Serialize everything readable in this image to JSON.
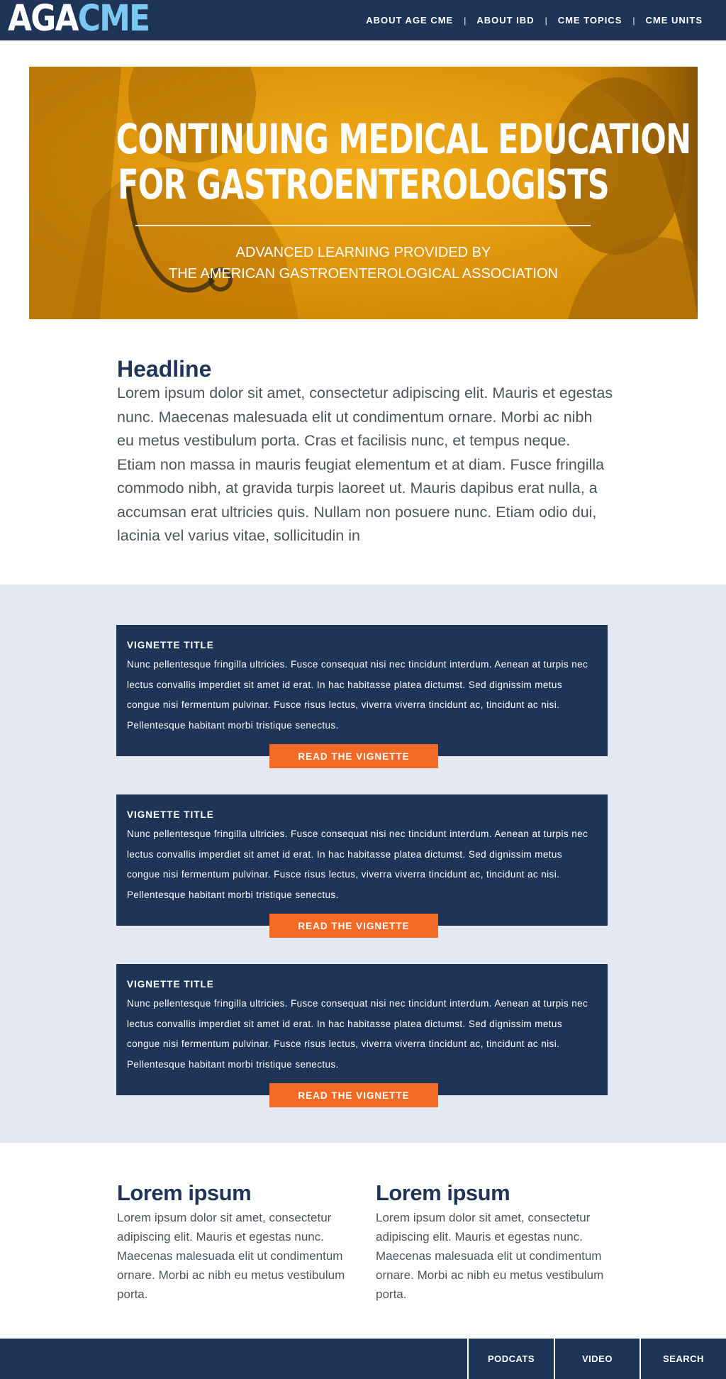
{
  "header": {
    "logo": {
      "part1": "AGA",
      "part2": "CME"
    },
    "nav": [
      {
        "label": "ABOUT AGE CME"
      },
      {
        "label": "ABOUT IBD"
      },
      {
        "label": "CME TOPICS"
      },
      {
        "label": "CME UNITS"
      }
    ],
    "nav_separator": "|"
  },
  "hero": {
    "title_line1": "CONTINUING MEDICAL EDUCATION",
    "title_line2": "FOR GASTROENTEROLOGISTS",
    "subtitle_line1": "ADVANCED LEARNING PROVIDED BY",
    "subtitle_line2": "THE AMERICAN GASTROENTEROLOGICAL ASSOCIATION",
    "tint_color": "#e79a07"
  },
  "intro": {
    "headline": "Headline",
    "body": "Lorem ipsum dolor sit amet, consectetur adipiscing elit. Mauris et egestas nunc. Maecenas malesuada elit ut condimentum ornare. Morbi ac nibh eu metus vestibulum porta. Cras et facilisis nunc, et tempus neque. Etiam non massa in mauris feugiat elementum et at diam. Fusce fringilla commodo nibh, at gravida turpis laoreet ut. Mauris dapibus erat nulla, a accumsan erat ultricies quis. Nullam non posuere nunc. Etiam odio dui, lacinia vel varius vitae, sollicitudin in"
  },
  "vignettes": [
    {
      "title": "VIGNETTE TITLE",
      "body": "Nunc pellentesque fringilla ultricies. Fusce consequat nisi nec tincidunt interdum. Aenean at turpis nec lectus convallis imperdiet sit amet id erat. In hac habitasse platea dictumst. Sed dignissim metus congue nisi fermentum pulvinar. Fusce risus lectus, viverra viverra tincidunt ac, tincidunt ac nisi. Pellentesque habitant morbi tristique senectus.",
      "button": "READ THE VIGNETTE"
    },
    {
      "title": "VIGNETTE TITLE",
      "body": "Nunc pellentesque fringilla ultricies. Fusce consequat nisi nec tincidunt interdum. Aenean at turpis nec lectus convallis imperdiet sit amet id erat. In hac habitasse platea dictumst. Sed dignissim metus congue nisi fermentum pulvinar. Fusce risus lectus, viverra viverra tincidunt ac, tincidunt ac nisi. Pellentesque habitant morbi tristique senectus.",
      "button": "READ THE VIGNETTE"
    },
    {
      "title": "VIGNETTE TITLE",
      "body": "Nunc pellentesque fringilla ultricies. Fusce consequat nisi nec tincidunt interdum. Aenean at turpis nec lectus convallis imperdiet sit amet id erat. In hac habitasse platea dictumst. Sed dignissim metus congue nisi fermentum pulvinar. Fusce risus lectus, viverra viverra tincidunt ac, tincidunt ac nisi. Pellentesque habitant morbi tristique senectus.",
      "button": "READ THE VIGNETTE"
    }
  ],
  "columns": [
    {
      "heading": "Lorem ipsum",
      "body": "Lorem ipsum dolor sit amet, consectetur adipiscing elit. Mauris et egestas nunc. Maecenas malesuada elit ut condimentum ornare. Morbi ac nibh eu metus vestibulum porta."
    },
    {
      "heading": "Lorem ipsum",
      "body": "Lorem ipsum dolor sit amet, consectetur adipiscing elit. Mauris et egestas nunc. Maecenas malesuada elit ut condimentum ornare. Morbi ac nibh eu metus vestibulum porta."
    }
  ],
  "footer": {
    "links": [
      {
        "label": "PODCATS"
      },
      {
        "label": "VIDEO"
      },
      {
        "label": "SEARCH"
      }
    ]
  },
  "colors": {
    "navy": "#1f3558",
    "accent_blue": "#7cc8f2",
    "orange_button": "#f26a25",
    "band_background": "#e4e9f1",
    "body_text": "#4e5459"
  }
}
